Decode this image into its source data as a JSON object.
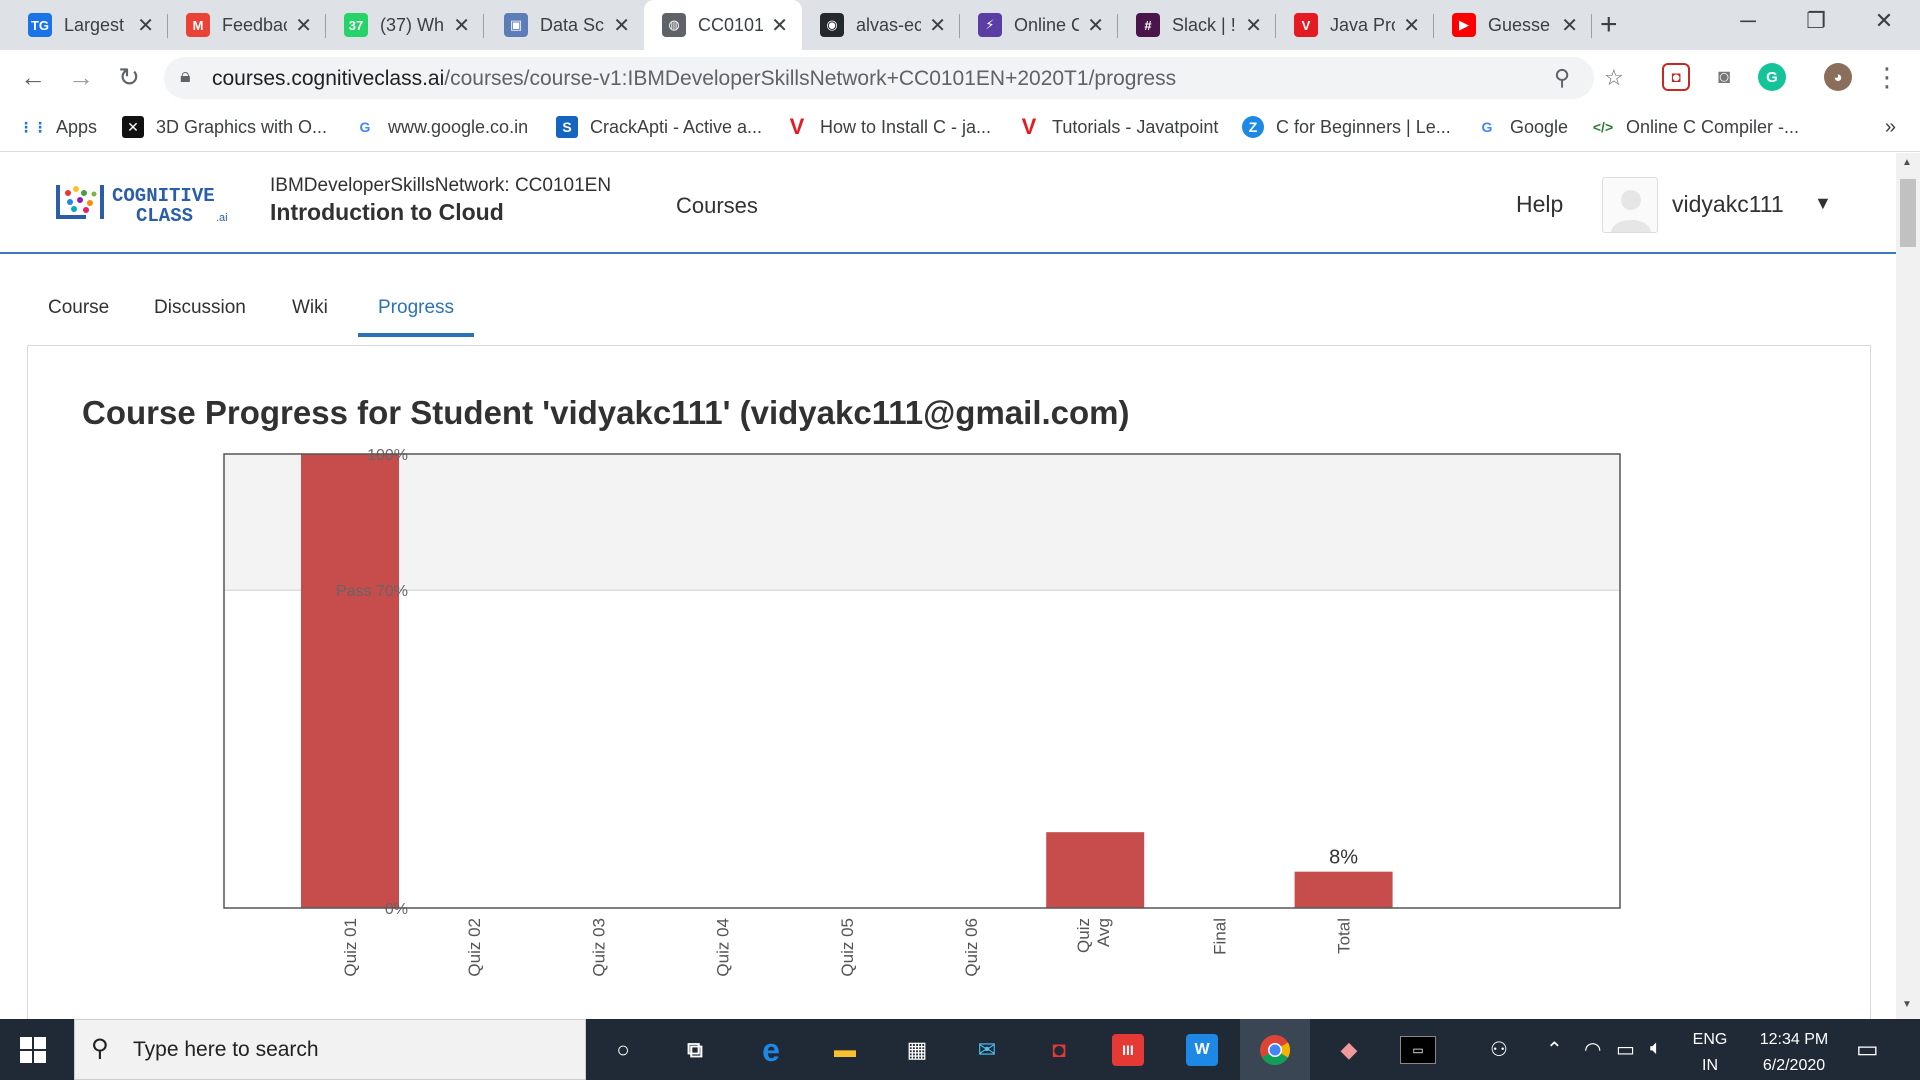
{
  "browser": {
    "tabs": [
      {
        "title": "Largest",
        "favicon": "TG",
        "color": "#1a73e8"
      },
      {
        "title": "Feedback",
        "favicon": "M",
        "color": "#ea4335"
      },
      {
        "title": "(37) Wh",
        "favicon": "37",
        "color": "#25d366"
      },
      {
        "title": "Data Sc",
        "favicon": "▣",
        "color": "#5b7db8"
      },
      {
        "title": "CC0101",
        "favicon": "◍",
        "color": "#5f6368"
      },
      {
        "title": "alvas-ec",
        "favicon": "◉",
        "color": "#24292e"
      },
      {
        "title": "Online C",
        "favicon": "⚡",
        "color": "#5b3ea4"
      },
      {
        "title": "Slack | !",
        "favicon": "#",
        "color": "#4a154b"
      },
      {
        "title": "Java Pro",
        "favicon": "V",
        "color": "#e41b23"
      },
      {
        "title": "Guesse",
        "favicon": "▶",
        "color": "#ff0000"
      }
    ],
    "active_tab_index": 4,
    "url_host": "courses.cognitiveclass.ai",
    "url_path": "/courses/course-v1:IBMDeveloperSkillsNetwork+CC0101EN+2020T1/progress",
    "bookmarks": [
      {
        "label": "Apps",
        "icon": "apps-grid-icon",
        "glyph": "⋮⋮",
        "color": "#1a73e8"
      },
      {
        "label": "3D Graphics with O...",
        "icon": "3d-graphics-icon",
        "glyph": "✕",
        "color": "#111111"
      },
      {
        "label": "www.google.co.in",
        "icon": "google-icon",
        "glyph": "G",
        "color": "#4285f4"
      },
      {
        "label": "CrackApti - Active a...",
        "icon": "crackapti-icon",
        "glyph": "S",
        "color": "#1565c0"
      },
      {
        "label": "How to Install C - ja...",
        "icon": "javatpoint-icon",
        "glyph": "V",
        "color": "#e41b23"
      },
      {
        "label": "Tutorials - Javatpoint",
        "icon": "javatpoint-icon",
        "glyph": "V",
        "color": "#e41b23"
      },
      {
        "label": "C for Beginners | Le...",
        "icon": "c-beginners-icon",
        "glyph": "Z",
        "color": "#1e88e5"
      },
      {
        "label": "Google",
        "icon": "google-icon",
        "glyph": "G",
        "color": "#4285f4"
      },
      {
        "label": "Online C Compiler -...",
        "icon": "code-icon",
        "glyph": "</>",
        "color": "#2e7d32"
      }
    ]
  },
  "header": {
    "logo_line1": "COGNITIVE",
    "logo_line2": "CLASS",
    "logo_suffix": ".ai",
    "course_org": "IBMDeveloperSkillsNetwork: CC0101EN",
    "course_name": "Introduction to Cloud",
    "nav_courses": "Courses",
    "help": "Help",
    "username": "vidyakc111"
  },
  "course_tabs": [
    {
      "label": "Course",
      "active": false
    },
    {
      "label": "Discussion",
      "active": false
    },
    {
      "label": "Wiki",
      "active": false
    },
    {
      "label": "Progress",
      "active": true
    }
  ],
  "progress": {
    "title": "Course Progress for Student 'vidyakc111' (vidyakc111@gmail.com)"
  },
  "chart_data": {
    "type": "bar",
    "categories": [
      "Quiz 01",
      "Quiz 02",
      "Quiz 03",
      "Quiz 04",
      "Quiz 05",
      "Quiz 06",
      "Quiz Avg",
      "Final",
      "Total"
    ],
    "values": [
      100,
      0,
      0,
      0,
      0,
      0,
      16.7,
      0,
      8
    ],
    "ylim": [
      0,
      100
    ],
    "y_ticks": [
      "0%",
      "Pass 70%",
      "100%"
    ],
    "y_tick_values": [
      0,
      70,
      100
    ],
    "pass_threshold": 70,
    "data_labels": [
      {
        "index": 8,
        "text": "8%"
      }
    ],
    "bar_color": "#c74c4c",
    "pass_band_color": "#f3f3f3"
  },
  "taskbar": {
    "search_placeholder": "Type here to search",
    "lang_line1": "ENG",
    "lang_line2": "IN",
    "time": "12:34 PM",
    "date": "6/2/2020"
  }
}
